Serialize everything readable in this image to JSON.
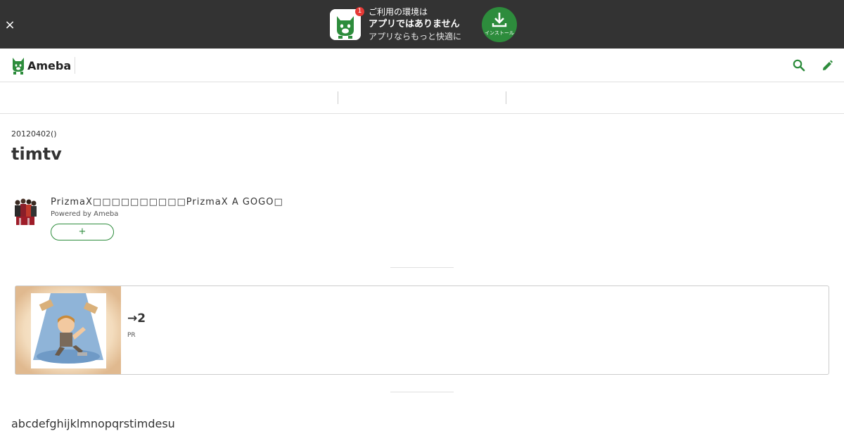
{
  "app_banner": {
    "close_symbol": "×",
    "badge_count": "1",
    "line1": "ご利用の環境は",
    "line2": "アプリではありません",
    "line3": "アプリならもっと快適に",
    "install_label": "インストール",
    "icons": {
      "close": "close-icon",
      "app": "ameba-app-icon",
      "install": "download-icon"
    },
    "colors": {
      "background": "#333333",
      "install_button": "#2d8c3c",
      "badge": "#e53935"
    }
  },
  "header": {
    "logo_text": "Ameba",
    "icons": {
      "search": "search-icon",
      "edit": "pencil-icon"
    },
    "colors": {
      "brand": "#2d8c3c"
    }
  },
  "article": {
    "date": "20120402()",
    "title": "timtv",
    "body": "abcdefghijklmnopqrstimdesu"
  },
  "blog": {
    "name": "PrizmaX□□□□□□□□□□PrizmaX A GOGO□",
    "powered_by": "Powered by Ameba",
    "follow_label": "+"
  },
  "pr_card": {
    "title": "→2",
    "label": "PR"
  }
}
